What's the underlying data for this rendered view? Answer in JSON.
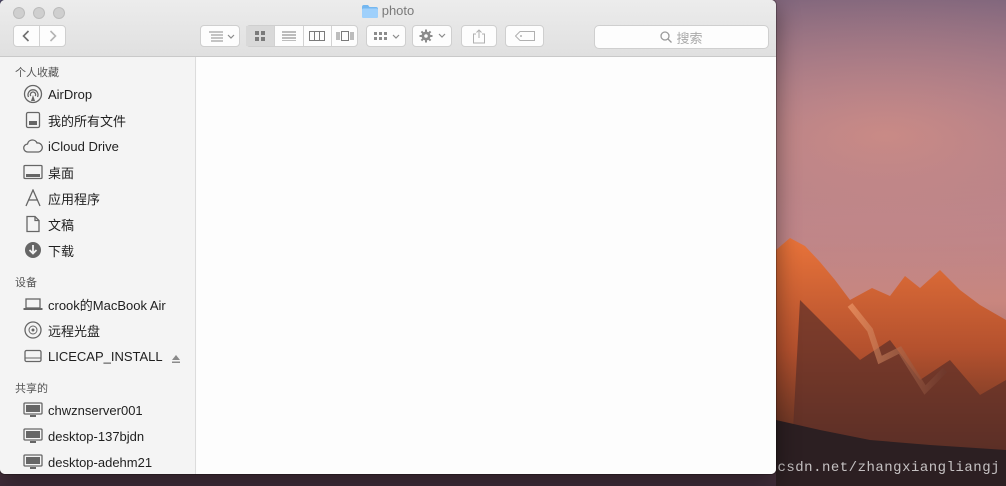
{
  "window": {
    "title": "photo"
  },
  "toolbar": {
    "back_icon": "chevron-left-icon",
    "forward_icon": "chevron-right-icon",
    "search_placeholder": "搜索"
  },
  "sidebar": {
    "favorites_header": "个人收藏",
    "favorites": [
      {
        "label": "AirDrop",
        "icon": "airdrop-icon"
      },
      {
        "label": "我的所有文件",
        "icon": "all-files-icon"
      },
      {
        "label": "iCloud Drive",
        "icon": "cloud-icon"
      },
      {
        "label": "桌面",
        "icon": "desktop-icon"
      },
      {
        "label": "应用程序",
        "icon": "applications-icon"
      },
      {
        "label": "文稿",
        "icon": "documents-icon"
      },
      {
        "label": "下载",
        "icon": "download-icon"
      }
    ],
    "devices_header": "设备",
    "devices": [
      {
        "label": "crook的MacBook Air",
        "icon": "laptop-icon"
      },
      {
        "label": "远程光盘",
        "icon": "disc-icon"
      },
      {
        "label": "LICECAP_INSTALL",
        "icon": "drive-icon"
      }
    ],
    "shared_header": "共享的",
    "shared": [
      {
        "label": "chwznserver001",
        "icon": "monitor-icon"
      },
      {
        "label": "desktop-137bjdn",
        "icon": "monitor-icon"
      },
      {
        "label": "desktop-adehm21",
        "icon": "monitor-icon"
      }
    ]
  },
  "watermark": "http://blog.csdn.net/zhangxiangliangj"
}
